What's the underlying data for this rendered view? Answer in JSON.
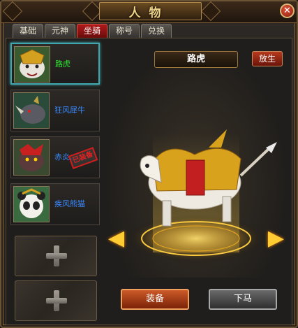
{
  "window": {
    "title": "人物",
    "close_glyph": "✕"
  },
  "tabs": [
    {
      "label": "基础",
      "active": false
    },
    {
      "label": "元神",
      "active": false
    },
    {
      "label": "坐骑",
      "active": true
    },
    {
      "label": "称号",
      "active": false
    },
    {
      "label": "兑换",
      "active": false
    }
  ],
  "mounts": [
    {
      "name": "路虎",
      "name_color": "#2ee52e",
      "selected": true
    },
    {
      "name": "狂风犀牛",
      "name_color": "#3a8aff",
      "selected": false
    },
    {
      "name": "赤炎...",
      "name_color": "#3a8aff",
      "selected": false,
      "stamp": "已装备"
    },
    {
      "name": "疾风熊猫",
      "name_color": "#3a8aff",
      "selected": false
    }
  ],
  "empty_slots": 2,
  "preview": {
    "mount_name": "路虎",
    "release_label": "放生",
    "equip_label": "装备",
    "dismount_label": "下马"
  },
  "colors": {
    "accent_gold": "#f0d48a",
    "tab_active": "#b0191a",
    "selection": "#3ea8ae",
    "equip_btn": "#cc5a28"
  }
}
